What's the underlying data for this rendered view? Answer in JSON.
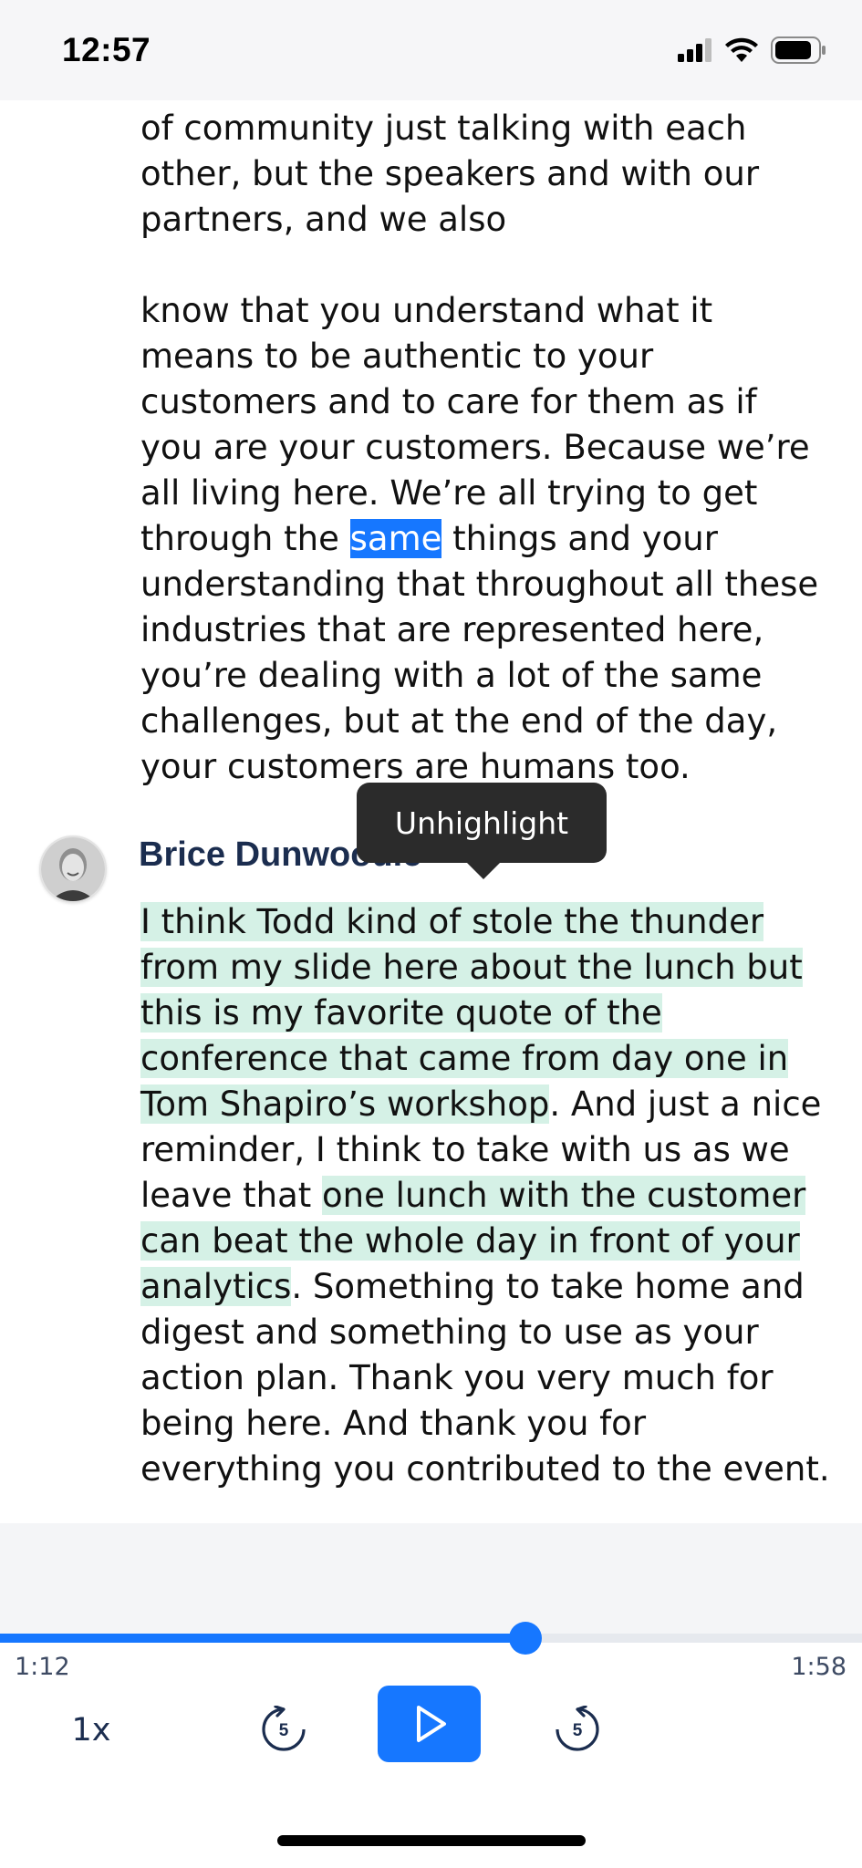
{
  "status_bar": {
    "time": "12:57",
    "icons": [
      "signal-icon",
      "wifi-icon",
      "battery-icon"
    ]
  },
  "transcript": {
    "paragraph_1_lines": "of community just talking with each\nother, but the speakers and with our\npartners, and we also",
    "paragraph_2": {
      "before": "know that you understand what it\nmeans to be authentic to your\ncustomers and to care for them as if\nyou are your customers. Because we’re\nall living here. We’re all trying to get\nthrough the ",
      "selected_word": "same",
      "after": " things and your\nunderstanding that throughout all these\nindustries that are represented here,\nyou’re dealing with a lot of the same\nchallenges, but at the end of the day,\nyour customers are humans too."
    },
    "speaker": {
      "name": "Brice Dunwoodie",
      "avatar_icon": "person-avatar-icon"
    },
    "paragraph_3": {
      "highlight_1": "I think Todd kind of stole the thunder\nfrom my slide here about the lunch but\nthis is my favorite quote of the\nconference that came from day one in\nTom Shapiro’s workshop",
      "middle": ". And just a nice\nreminder, I think to take with us as we\nleave that ",
      "highlight_2": "one lunch with the customer\ncan beat the whole day in front of your\nanalytics",
      "end": ". Something to take home and\ndigest and something to use as your\naction plan. Thank you very much for\nbeing here. And thank you for\neverything you contributed to the event."
    }
  },
  "tooltip": {
    "label": "Unhighlight"
  },
  "player": {
    "elapsed": "1:12",
    "total": "1:58",
    "progress_fraction": 0.61,
    "speed_label": "1x",
    "rewind_seconds": "5",
    "forward_seconds": "5"
  },
  "colors": {
    "accent": "#1677ff",
    "highlight": "#d5f1e6",
    "speaker_name": "#1b2d4f",
    "tooltip_bg": "#2b2b2b"
  }
}
